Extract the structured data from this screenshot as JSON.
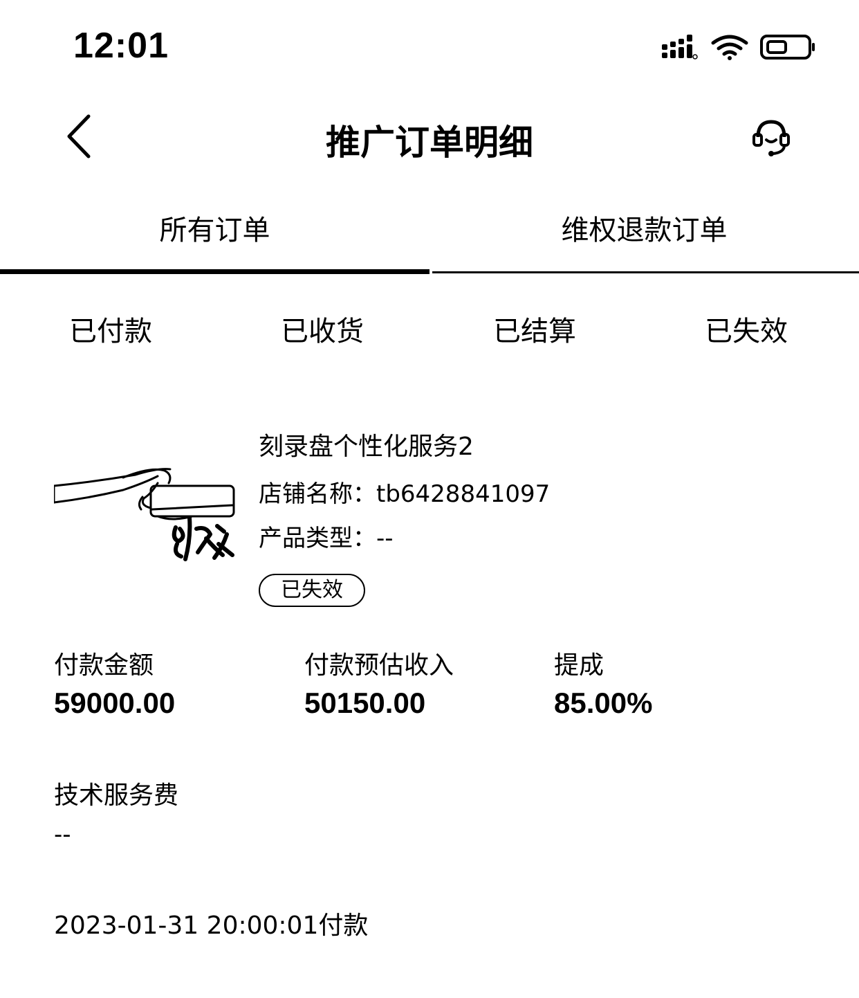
{
  "status_bar": {
    "time": "12:01"
  },
  "header": {
    "title": "推广订单明细"
  },
  "tabs": [
    {
      "label": "所有订单",
      "active": true
    },
    {
      "label": "维权退款订单",
      "active": false
    }
  ],
  "sub_filters": [
    {
      "label": "已付款"
    },
    {
      "label": "已收货"
    },
    {
      "label": "已结算"
    },
    {
      "label": "已失效"
    }
  ],
  "order": {
    "title": "刻录盘个性化服务2",
    "shop_line": "店铺名称：tb6428841097",
    "type_line": "产品类型：--",
    "status": "已失效",
    "stats": [
      {
        "label": "付款金额",
        "value": "59000.00"
      },
      {
        "label": "付款预估收入",
        "value": "50150.00"
      },
      {
        "label": "提成",
        "value": "85.00%"
      }
    ],
    "fee_label": "技术服务费",
    "fee_value": "--",
    "paid_time": "2023-01-31 20:00:01付款"
  }
}
